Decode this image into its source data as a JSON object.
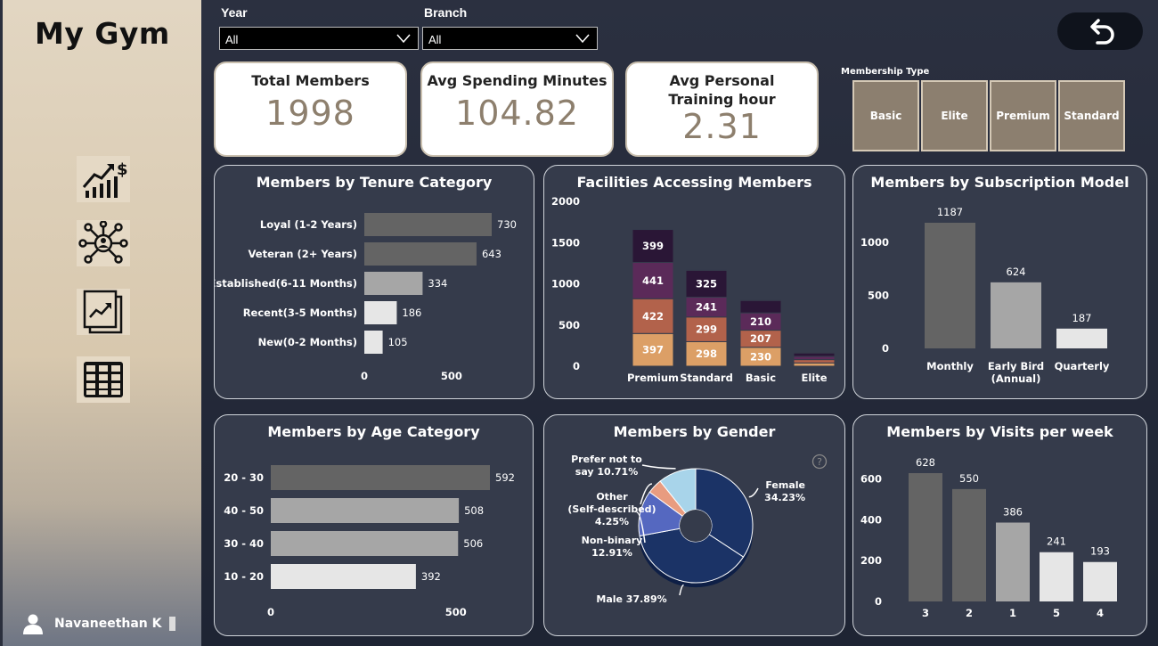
{
  "app": {
    "title": "My Gym"
  },
  "sidebar": {
    "nav": [
      {
        "icon": "growth-chart-dollar-icon"
      },
      {
        "icon": "network-people-icon"
      },
      {
        "icon": "trend-pages-icon"
      },
      {
        "icon": "table-grid-icon"
      }
    ],
    "user": {
      "icon": "user-icon",
      "name": "Navaneethan K"
    }
  },
  "filters": {
    "year": {
      "label": "Year",
      "value": "All"
    },
    "branch": {
      "label": "Branch",
      "value": "All"
    }
  },
  "back_button": {
    "icon": "back-arrow-icon"
  },
  "kpis": {
    "total_members": {
      "label": "Total Members",
      "value": "1998"
    },
    "avg_spending": {
      "label": "Avg Spending Minutes",
      "value": "104.82"
    },
    "avg_training": {
      "label": "Avg Personal Training hour",
      "value": "2.31"
    }
  },
  "membership_type": {
    "title": "Membership Type",
    "options": [
      "Basic",
      "Elite",
      "Premium",
      "Standard"
    ]
  },
  "colors": {
    "dark_gray": "#646464",
    "mid_gray": "#a6a6a6",
    "light_gray": "#e6e6e6",
    "facility_1": "#2a1636",
    "facility_2": "#5b2a59",
    "facility_3": "#b2624b",
    "facility_4": "#dc9f66",
    "navy": "#1b3366",
    "royal": "#5568c0",
    "salmon": "#e89c80",
    "skyblue": "#a8d4ea"
  },
  "chart_data": [
    {
      "id": "tenure",
      "type": "bar",
      "orientation": "horizontal",
      "title": "Members by Tenure Category",
      "categories": [
        "Loyal (1-2 Years)",
        "Veteran (2+ Years)",
        "Established(6-11 Months)",
        "Recent(3-5 Months)",
        "New(0-2 Months)"
      ],
      "values": [
        730,
        643,
        334,
        186,
        105
      ],
      "xticks": [
        "0",
        "500"
      ],
      "xlim": [
        0,
        730
      ]
    },
    {
      "id": "facilities",
      "type": "bar",
      "stacked": true,
      "title": "Facilities Accessing Members",
      "categories": [
        "Premium",
        "Standard",
        "Basic",
        "Elite"
      ],
      "series": [
        {
          "values": [
            397,
            298,
            230,
            40
          ]
        },
        {
          "values": [
            422,
            299,
            207,
            40
          ]
        },
        {
          "values": [
            441,
            241,
            210,
            40
          ]
        },
        {
          "values": [
            399,
            325,
            150,
            40
          ]
        }
      ],
      "yticks": [
        "0",
        "500",
        "1000",
        "1500",
        "2000"
      ],
      "ylim": [
        0,
        2000
      ]
    },
    {
      "id": "subscription",
      "type": "bar",
      "title": "Members by Subscription Model",
      "categories": [
        "Monthly",
        "Early Bird (Annual)",
        "Quarterly"
      ],
      "values": [
        1187,
        624,
        187
      ],
      "yticks": [
        "0",
        "500",
        "1000"
      ],
      "ylim": [
        0,
        1187
      ]
    },
    {
      "id": "age",
      "type": "bar",
      "orientation": "horizontal",
      "title": "Members by Age Category",
      "categories": [
        "20 - 30",
        "40 - 50",
        "30 - 40",
        "10 - 20"
      ],
      "values": [
        592,
        508,
        506,
        392
      ],
      "xticks": [
        "0",
        "500"
      ],
      "xlim": [
        0,
        592
      ]
    },
    {
      "id": "gender",
      "type": "pie",
      "title": "Members by Gender",
      "slices": [
        {
          "name": "Female",
          "value": 34.23,
          "label": "Female\n34.23%"
        },
        {
          "name": "Male",
          "value": 37.89,
          "label": "Male 37.89%"
        },
        {
          "name": "Non-binary",
          "value": 12.91,
          "label": "Non-binary\n12.91%"
        },
        {
          "name": "Other (Self-described)",
          "value": 4.25,
          "label": "Other\n(Self-described)\n4.25%"
        },
        {
          "name": "Prefer not to say",
          "value": 10.71,
          "label": "Prefer not to\nsay 10.71%"
        }
      ]
    },
    {
      "id": "visits",
      "type": "bar",
      "title": "Members by Visits per week",
      "categories": [
        "3",
        "2",
        "1",
        "5",
        "4"
      ],
      "values": [
        628,
        550,
        386,
        241,
        193
      ],
      "yticks": [
        "0",
        "200",
        "400",
        "600"
      ],
      "ylim": [
        0,
        628
      ]
    }
  ]
}
